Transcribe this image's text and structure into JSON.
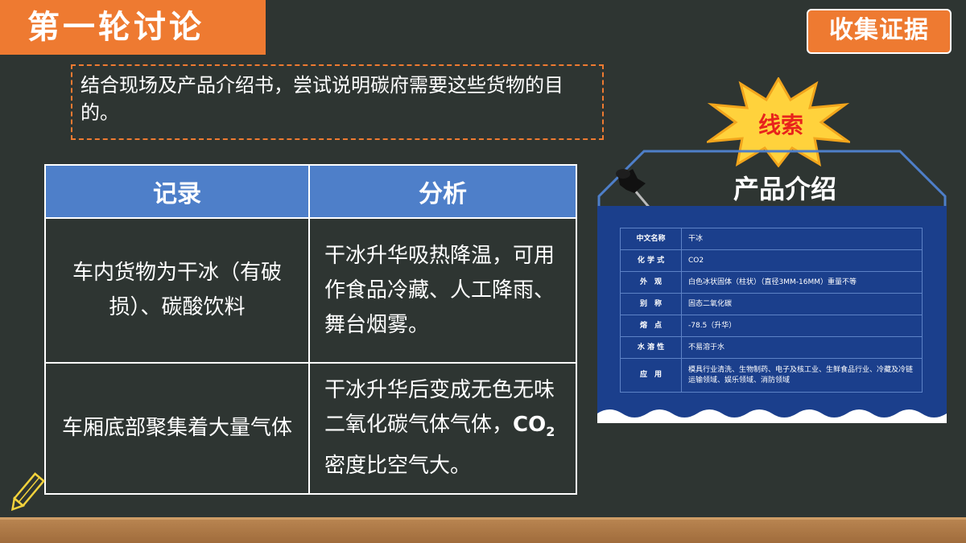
{
  "header": {
    "title": "第一轮讨论",
    "action_button": "收集证据"
  },
  "question": "结合现场及产品介绍书，尝试说明碳府需要这些货物的目的。",
  "table": {
    "headers": [
      "记录",
      "分析"
    ],
    "rows": [
      {
        "record": "车内货物为干冰（有破损）、碳酸饮料",
        "analysis": "干冰升华吸热降温，可用作食品冷藏、人工降雨、舞台烟雾。"
      },
      {
        "record": "车厢底部聚集着大量气体",
        "analysis_prefix": "干冰升华后变成无色无味二氧化碳气体气体，",
        "co2_main": "CO",
        "co2_sub": "2",
        "analysis_suffix": "密度比空气大。"
      }
    ]
  },
  "clue_label": "线索",
  "product_card": {
    "title": "产品介绍",
    "rows": [
      {
        "label": "中文名称",
        "value": "干冰"
      },
      {
        "label": "化 学 式",
        "value": "CO2"
      },
      {
        "label": "外　观",
        "value": "白色冰状固体（柱状）（直径3MM-16MM）重量不等"
      },
      {
        "label": "别　称",
        "value": "固态二氧化碳"
      },
      {
        "label": "熔　点",
        "value": "-78.5（升华）"
      },
      {
        "label": "水 溶 性",
        "value": "不易溶于水"
      },
      {
        "label": "应　用",
        "value": "模具行业清洗、生物制药、电子及核工业、生鲜食品行业、冷藏及冷链运输领域、娱乐领域、消防领域"
      }
    ]
  },
  "colors": {
    "background": "#2e3532",
    "accent_orange": "#ee7a31",
    "table_header_blue": "#4e7fc9",
    "card_navy": "#1b3f8c",
    "clue_red": "#e8231c",
    "starburst_yellow": "#ffd23c"
  },
  "icons": [
    "pushpin-icon",
    "pencil-icon",
    "starburst-icon"
  ]
}
